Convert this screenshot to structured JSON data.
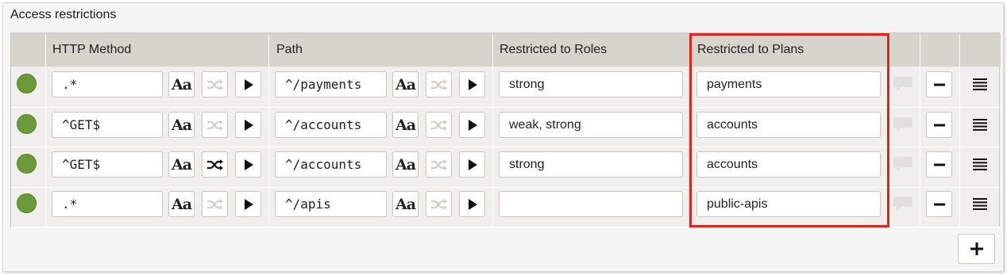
{
  "panel": {
    "title": "Access restrictions"
  },
  "columns": {
    "http_method": "HTTP Method",
    "path": "Path",
    "roles": "Restricted to Roles",
    "plans": "Restricted to Plans"
  },
  "rows": [
    {
      "status": "enabled",
      "method": ".*",
      "path": "^/payments",
      "roles": "strong",
      "plans": "payments",
      "method_regex_active": false,
      "path_regex_active": false
    },
    {
      "status": "enabled",
      "method": "^GET$",
      "path": "^/accounts",
      "roles": "weak, strong",
      "plans": "accounts",
      "method_regex_active": false,
      "path_regex_active": false
    },
    {
      "status": "enabled",
      "method": "^GET$",
      "path": "^/accounts",
      "roles": "strong",
      "plans": "accounts",
      "method_regex_active": true,
      "path_regex_active": false
    },
    {
      "status": "enabled",
      "method": ".*",
      "path": "^/apis",
      "roles": "",
      "plans": "public-apis",
      "method_regex_active": false,
      "path_regex_active": false
    }
  ],
  "icons": {
    "case": "Aa",
    "status": "green-dot-icon",
    "shuffle": "shuffle-icon",
    "play": "play-icon",
    "comment": "comment-icon",
    "remove": "minus-icon",
    "drag": "drag-handle-icon",
    "add": "plus-icon"
  },
  "colors": {
    "status_green": "#6b9a3a",
    "highlight_red": "#e02418",
    "header_bg": "#d7d3cd"
  }
}
